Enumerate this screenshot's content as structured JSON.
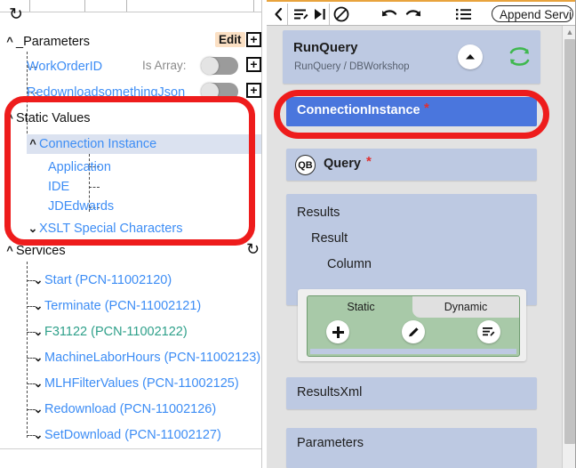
{
  "left_panel": {
    "refresh_icon": "refresh-icon",
    "parameters_section": {
      "label": "_Parameters",
      "edit_label": "Edit",
      "chevron": "chevron-up",
      "rows": [
        {
          "label": "WorkOrderID",
          "is_array_label": "Is Array:",
          "toggle_state": "off"
        },
        {
          "label": "RedownloadsomethingJson",
          "is_array_label": "Is Array:",
          "toggle_state": "off"
        }
      ]
    },
    "static_values_section": {
      "label": "Static Values",
      "chevron": "chevron-up",
      "items": [
        {
          "label": "Connection Instance",
          "chevron": "chevron-up",
          "selected": true
        },
        {
          "label": "Application",
          "chevron": "",
          "selected": false
        },
        {
          "label": "IDE",
          "chevron": "",
          "selected": false
        },
        {
          "label": "JDEdwards",
          "chevron": "",
          "selected": false
        },
        {
          "label": "XSLT Special Characters",
          "chevron": "chevron-down",
          "selected": false
        }
      ]
    },
    "services_section": {
      "label": "Services",
      "chevron": "chevron-up",
      "refresh_icon": "refresh-icon",
      "items": [
        {
          "label": "Start (PCN-11002120)",
          "color": "blue"
        },
        {
          "label": "Terminate (PCN-11002121)",
          "color": "blue"
        },
        {
          "label": "F31122 (PCN-11002122)",
          "color": "green"
        },
        {
          "label": "MachineLaborHours (PCN-11002123)",
          "color": "blue"
        },
        {
          "label": "MLHFilterValues (PCN-11002125)",
          "color": "blue"
        },
        {
          "label": "Redownload (PCN-11002126)",
          "color": "blue"
        },
        {
          "label": "SetDownload (PCN-11002127)",
          "color": "blue"
        }
      ]
    }
  },
  "right_panel": {
    "toolbar": {
      "back_icon": "chevron-left-icon",
      "edit_lines_icon": "edit-lines-icon",
      "step-forward_icon": "step-forward-icon",
      "disable_icon": "no-entry-icon",
      "undo_icon": "undo-icon",
      "redo_icon": "redo-icon",
      "list_icon": "list-icon",
      "append_placeholder": "Append Service C"
    },
    "header_card": {
      "title": "RunQuery",
      "subtitle": "RunQuery / DBWorkshop",
      "collapse_icon": "chevron-up-icon",
      "sync_icon": "sync-icon"
    },
    "connection_instance": {
      "label": "ConnectionInstance",
      "required_marker": "*",
      "selected": true
    },
    "query_row": {
      "badge": "QB",
      "label": "Query",
      "required_marker": "*"
    },
    "results_card": {
      "lines": [
        "Results",
        "Result",
        "Column"
      ],
      "tabs": [
        {
          "label": "Static",
          "active": true
        },
        {
          "label": "Dynamic",
          "active": false
        }
      ],
      "actions": [
        {
          "icon": "plus-icon",
          "name": "add-button"
        },
        {
          "icon": "pencil-icon",
          "name": "edit-button"
        },
        {
          "icon": "edit-lines-icon",
          "name": "edit-lines-button"
        }
      ]
    },
    "results_xml_card": {
      "label": "ResultsXml"
    },
    "parameters_card": {
      "label": "Parameters"
    },
    "scrollbar": {
      "up_arrow": "scroll-up-arrow"
    }
  },
  "annotations": {
    "highlight_color": "#EE1C1C",
    "regions": [
      {
        "name": "static-values-highlight"
      },
      {
        "name": "connection-instance-highlight"
      }
    ]
  }
}
